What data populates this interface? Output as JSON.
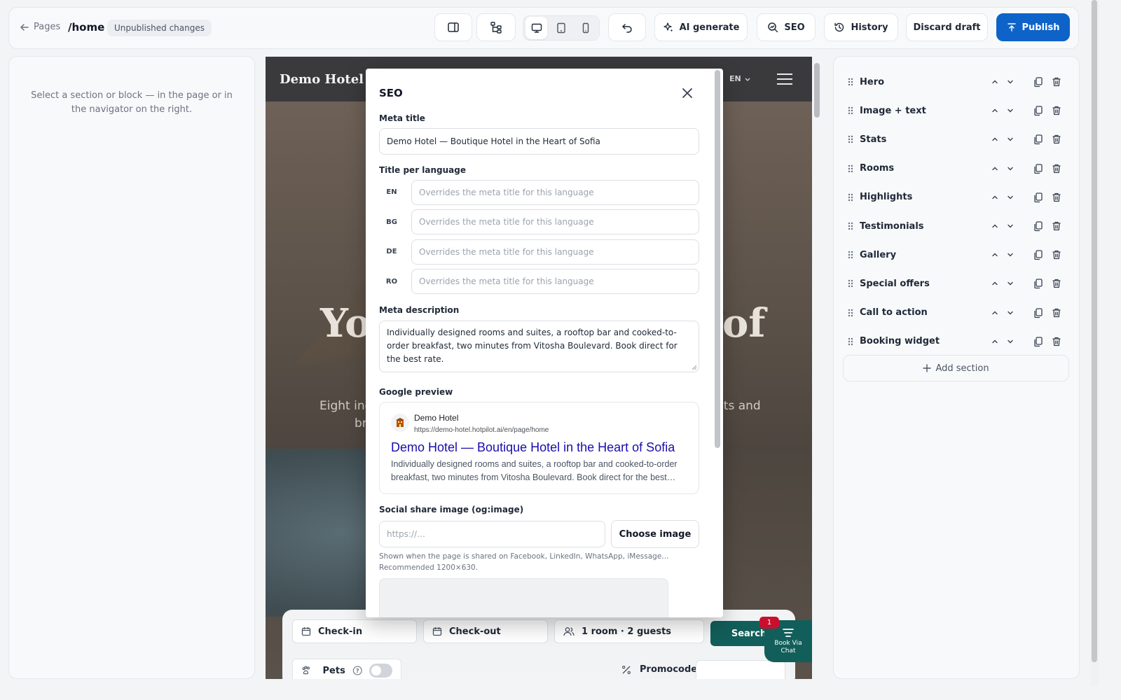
{
  "topbar": {
    "back_label": "Pages",
    "path": "/home",
    "status_pill": "Unpublished changes",
    "ai_label": "AI generate",
    "seo_label": "SEO",
    "history_label": "History",
    "discard_label": "Discard draft",
    "publish_label": "Publish"
  },
  "left_panel": {
    "hint": "Select a section or block — in the page or in the navigator on the right."
  },
  "canvas": {
    "logo": "Demo Hotel",
    "lang": "EN",
    "hero_left": "Yo",
    "hero_right": "of",
    "sub_left": "Eight ind",
    "sub_left2": "br",
    "sub_right": "nts and",
    "booking": {
      "checkin": "Check-in",
      "checkout": "Check-out",
      "guests": "1 room · 2 guests",
      "search": "Search",
      "pets": "Pets",
      "promocode": "Promocode",
      "chat_badge": "1",
      "chat_label": "Book Via Chat"
    }
  },
  "modal": {
    "title": "SEO",
    "meta_title_label": "Meta title",
    "meta_title_value": "Demo Hotel — Boutique Hotel in the Heart of Sofia",
    "per_language_label": "Title per language",
    "languages": [
      {
        "code": "EN",
        "placeholder": "Overrides the meta title for this language"
      },
      {
        "code": "BG",
        "placeholder": "Overrides the meta title for this language"
      },
      {
        "code": "DE",
        "placeholder": "Overrides the meta title for this language"
      },
      {
        "code": "RO",
        "placeholder": "Overrides the meta title for this language"
      }
    ],
    "meta_desc_label": "Meta description",
    "meta_desc_value": "Individually designed rooms and suites, a rooftop bar and cooked-to-order breakfast, two minutes from Vitosha Boulevard. Book direct for the best rate.",
    "google_label": "Google preview",
    "google": {
      "site_name": "Demo Hotel",
      "url": "https://demo-hotel.hotpilot.ai/en/page/home",
      "title": "Demo Hotel — Boutique Hotel in the Heart of Sofia",
      "desc": "Individually designed rooms and suites, a rooftop bar and cooked-to-order breakfast, two minutes from Vitosha Boulevard. Book direct for the best…"
    },
    "og_label": "Social share image (og:image)",
    "og_placeholder": "https://…",
    "choose_image": "Choose image",
    "og_hint1": "Shown when the page is shared on Facebook, LinkedIn, WhatsApp, iMessage…",
    "og_hint2": "Recommended 1200×630."
  },
  "navigator": {
    "sections": [
      "Hero",
      "Image + text",
      "Stats",
      "Rooms",
      "Highlights",
      "Testimonials",
      "Gallery",
      "Special offers",
      "Call to action",
      "Booking widget"
    ],
    "add_label": "Add section"
  },
  "colors": {
    "accent": "#0e63c9",
    "teal": "#125e5a",
    "badge": "#c8102e",
    "google_link": "#1a0dab"
  }
}
